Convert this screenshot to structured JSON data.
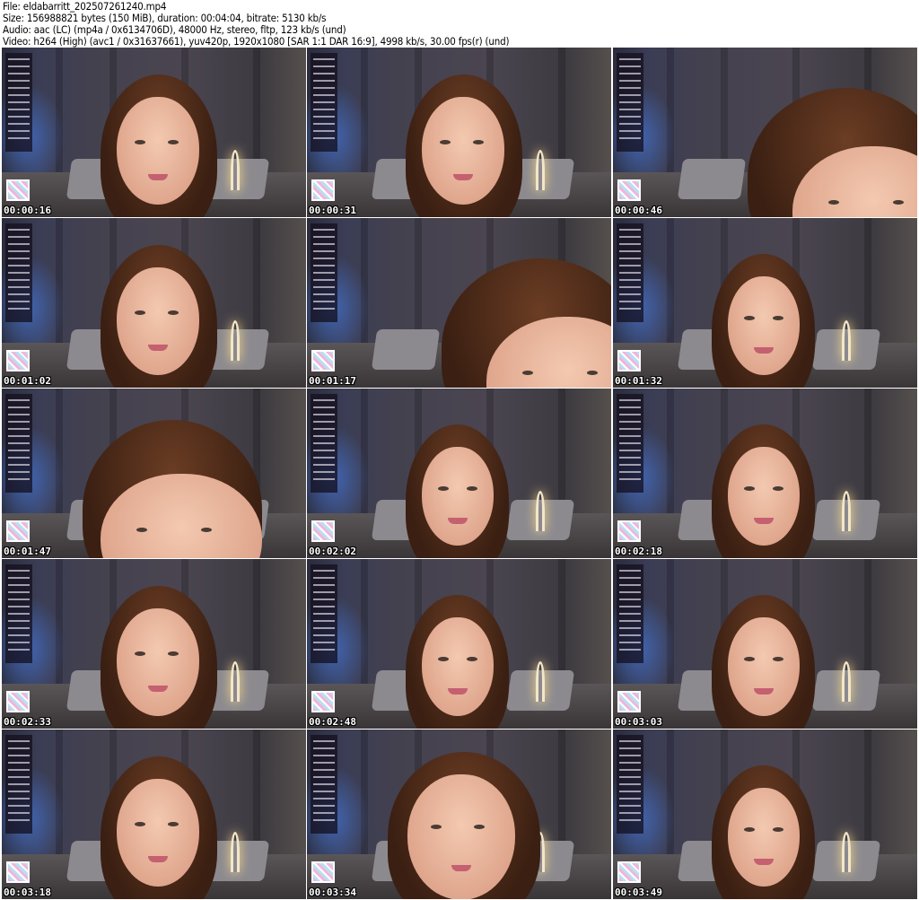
{
  "header": {
    "file": "File: eldabarritt_202507261240.mp4",
    "size": "Size: 156988821 bytes (150 MiB), duration: 00:04:04, bitrate: 5130 kb/s",
    "audio": "Audio: aac (LC) (mp4a / 0x6134706D), 48000 Hz, stereo, fltp, 123 kb/s (und)",
    "video": "Video: h264 (High) (avc1 / 0x31637661), yuv420p, 1920x1080 [SAR 1:1 DAR 16:9], 4998 kb/s, 30.00 fps(r) (und)"
  },
  "thumbnails": [
    {
      "timestamp": "00:00:16",
      "pose": "center"
    },
    {
      "timestamp": "00:00:31",
      "pose": "center"
    },
    {
      "timestamp": "00:00:46",
      "pose": "close"
    },
    {
      "timestamp": "00:01:02",
      "pose": "center"
    },
    {
      "timestamp": "00:01:17",
      "pose": "close"
    },
    {
      "timestamp": "00:01:32",
      "pose": "right"
    },
    {
      "timestamp": "00:01:47",
      "pose": "close-left"
    },
    {
      "timestamp": "00:02:02",
      "pose": "right"
    },
    {
      "timestamp": "00:02:18",
      "pose": "right"
    },
    {
      "timestamp": "00:02:33",
      "pose": "center"
    },
    {
      "timestamp": "00:02:48",
      "pose": "right"
    },
    {
      "timestamp": "00:03:03",
      "pose": "right"
    },
    {
      "timestamp": "00:03:18",
      "pose": "center"
    },
    {
      "timestamp": "00:03:34",
      "pose": "center-large"
    },
    {
      "timestamp": "00:03:49",
      "pose": "right"
    }
  ]
}
